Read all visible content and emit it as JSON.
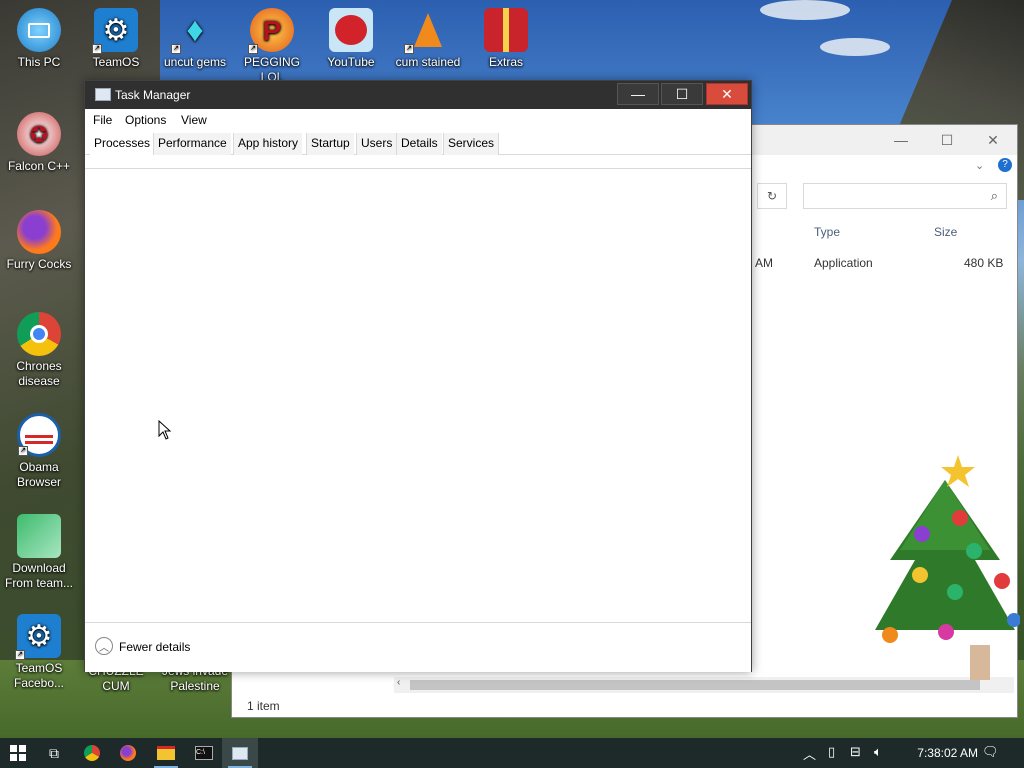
{
  "desktop": {
    "icons": [
      {
        "label": "This PC",
        "icon": "monitor-icon"
      },
      {
        "label": "TeamOS",
        "icon": "gear-icon"
      },
      {
        "label": "uncut gems",
        "icon": "diamond-icon"
      },
      {
        "label": "PEGGING LOL",
        "icon": "p-logo-icon"
      },
      {
        "label": "YouTube",
        "icon": "angry-bird-icon"
      },
      {
        "label": "cum stained",
        "icon": "cone-icon"
      },
      {
        "label": "Extras",
        "icon": "gift-icon"
      },
      {
        "label": "Falcon C++",
        "icon": "falcon-icon"
      },
      {
        "label": "Furry Cocks",
        "icon": "firefox-icon"
      },
      {
        "label": "Chrones disease",
        "icon": "chrome-icon"
      },
      {
        "label": "Obama Browser",
        "icon": "obama-logo-icon"
      },
      {
        "label": "Download From team...",
        "icon": "download-icon"
      },
      {
        "label": "TeamOS Facebo...",
        "icon": "gear-icon"
      },
      {
        "label": "CHUZZLE CUM",
        "icon": "app-icon"
      },
      {
        "label": "Jews invade Palestine",
        "icon": "app-icon"
      }
    ]
  },
  "explorer": {
    "columns": {
      "type": "Type",
      "size": "Size"
    },
    "row": {
      "date_fragment": "AM",
      "type": "Application",
      "size": "480 KB"
    },
    "status": "1 item"
  },
  "task_manager": {
    "title": "Task Manager",
    "menu": [
      "File",
      "Options",
      "View"
    ],
    "tabs": [
      "Processes",
      "Performance",
      "App history",
      "Startup",
      "Users",
      "Details",
      "Services"
    ],
    "active_tab": "Processes",
    "footer_label": "Fewer details"
  },
  "taskbar": {
    "clock": "7:38:02 AM"
  }
}
